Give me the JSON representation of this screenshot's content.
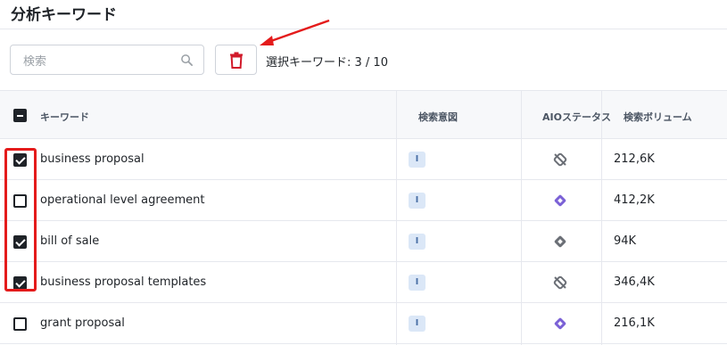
{
  "page": {
    "title": "分析キーワード"
  },
  "toolbar": {
    "search_placeholder": "検索",
    "search_value": "",
    "search_icon": "search-icon",
    "delete_icon": "trash-icon",
    "delete_color": "#d11a2a",
    "selected_label": "選択キーワード: 3 / 10"
  },
  "table": {
    "headers": {
      "keyword": "キーワード",
      "intent": "検索意図",
      "aio": "AIOステータス",
      "volume": "検索ボリューム"
    },
    "select_all_state": "indeterminate",
    "rows": [
      {
        "checked": true,
        "keyword": "business proposal",
        "intent": "I",
        "aio": "aio-not-present-icon",
        "volume": "212,6K"
      },
      {
        "checked": false,
        "keyword": "operational level agreement",
        "intent": "I",
        "aio": "aio-present-icon",
        "volume": "412,2K"
      },
      {
        "checked": true,
        "keyword": "bill of sale",
        "intent": "I",
        "aio": "aio-neutral-icon",
        "volume": "94K"
      },
      {
        "checked": true,
        "keyword": "business proposal templates",
        "intent": "I",
        "aio": "aio-not-present-icon",
        "volume": "346,4K"
      },
      {
        "checked": false,
        "keyword": "grant proposal",
        "intent": "I",
        "aio": "aio-present-icon",
        "volume": "216,1K"
      }
    ]
  },
  "colors": {
    "annotation_red": "#e41b1b",
    "aio_purple": "#7b61d6",
    "aio_gray": "#6b6f76",
    "intent_badge_bg": "#dbe7f7"
  }
}
